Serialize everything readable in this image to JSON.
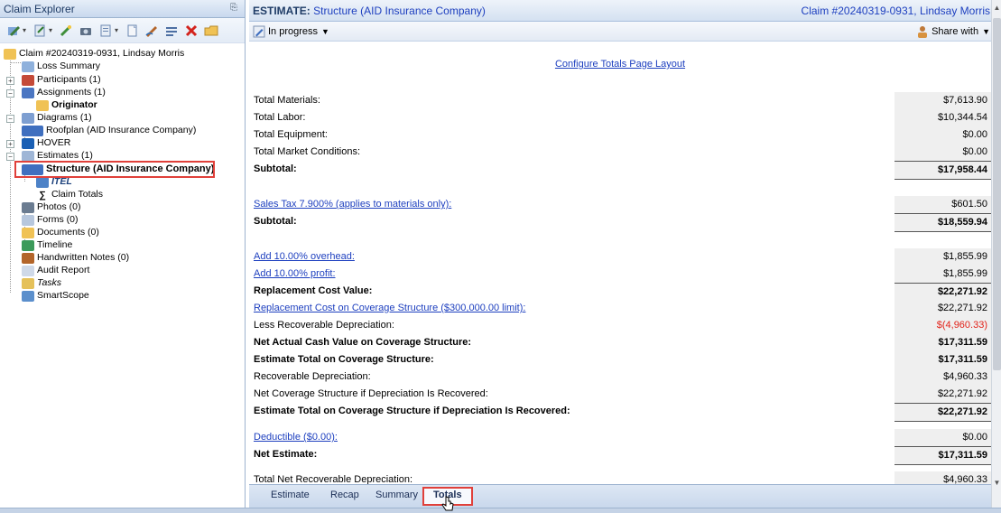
{
  "left_pane": {
    "title": "Claim Explorer",
    "tree": [
      {
        "label": "Claim #20240319-0931, Lindsay Morris"
      },
      {
        "label": "Loss Summary"
      },
      {
        "label": "Participants (1)"
      },
      {
        "label": "Assignments (1)"
      },
      {
        "label": "Originator"
      },
      {
        "label": "Diagrams (1)"
      },
      {
        "label": "Roofplan (AID Insurance Company)"
      },
      {
        "label": "HOVER"
      },
      {
        "label": "Estimates (1)"
      },
      {
        "label": "Structure (AID Insurance Company)"
      },
      {
        "label": "ITEL"
      },
      {
        "label": "Claim Totals"
      },
      {
        "label": "Photos (0)"
      },
      {
        "label": "Forms (0)"
      },
      {
        "label": "Documents (0)"
      },
      {
        "label": "Timeline"
      },
      {
        "label": "Handwritten Notes (0)"
      },
      {
        "label": "Audit Report"
      },
      {
        "label": "Tasks"
      },
      {
        "label": "SmartScope"
      }
    ]
  },
  "header": {
    "estimate_prefix": "ESTIMATE:",
    "estimate_name": "Structure (AID Insurance Company)",
    "claim": "Claim #20240319-0931, Lindsay Morris",
    "status": "In progress",
    "share": "Share with"
  },
  "content": {
    "configure_link": "Configure Totals Page Layout",
    "rows": [
      {
        "label": "Total Materials:",
        "value": "$7,613.90"
      },
      {
        "label": "Total Labor:",
        "value": "$10,344.54"
      },
      {
        "label": "Total Equipment:",
        "value": "$0.00"
      },
      {
        "label": "Total Market Conditions:",
        "value": "$0.00"
      },
      {
        "label": "Subtotal:",
        "value": "$17,958.44"
      },
      {
        "label": "Sales Tax 7.900% (applies to materials only):",
        "value": "$601.50"
      },
      {
        "label": "Subtotal:",
        "value": "$18,559.94"
      },
      {
        "label": "Add 10.00% overhead:",
        "value": "$1,855.99"
      },
      {
        "label": "Add 10.00% profit:",
        "value": "$1,855.99"
      },
      {
        "label": "Replacement Cost Value:",
        "value": "$22,271.92"
      },
      {
        "label": "Replacement Cost on Coverage Structure ($300,000.00 limit):",
        "value": "$22,271.92"
      },
      {
        "label": "Less Recoverable Depreciation:",
        "value": "$(4,960.33)"
      },
      {
        "label": "Net Actual Cash Value on Coverage Structure:",
        "value": "$17,311.59"
      },
      {
        "label": "Estimate Total on Coverage Structure:",
        "value": "$17,311.59"
      },
      {
        "label": "Recoverable Depreciation:",
        "value": "$4,960.33"
      },
      {
        "label": "Net Coverage Structure if Depreciation Is Recovered:",
        "value": "$22,271.92"
      },
      {
        "label": "Estimate Total on Coverage Structure if Depreciation Is Recovered:",
        "value": "$22,271.92"
      },
      {
        "label": "Deductible ($0.00):",
        "value": "$0.00"
      },
      {
        "label": "Net Estimate:",
        "value": "$17,311.59"
      },
      {
        "label": "Total Net Recoverable Depreciation:",
        "value": "$4,960.33"
      }
    ]
  },
  "tabs": [
    {
      "label": "Estimate"
    },
    {
      "label": "Recap"
    },
    {
      "label": "Summary"
    },
    {
      "label": "Totals",
      "active": true
    }
  ],
  "colors": {
    "link": "#1d3fbf",
    "negative": "#e2231a",
    "highlight_box": "#e0403a"
  }
}
